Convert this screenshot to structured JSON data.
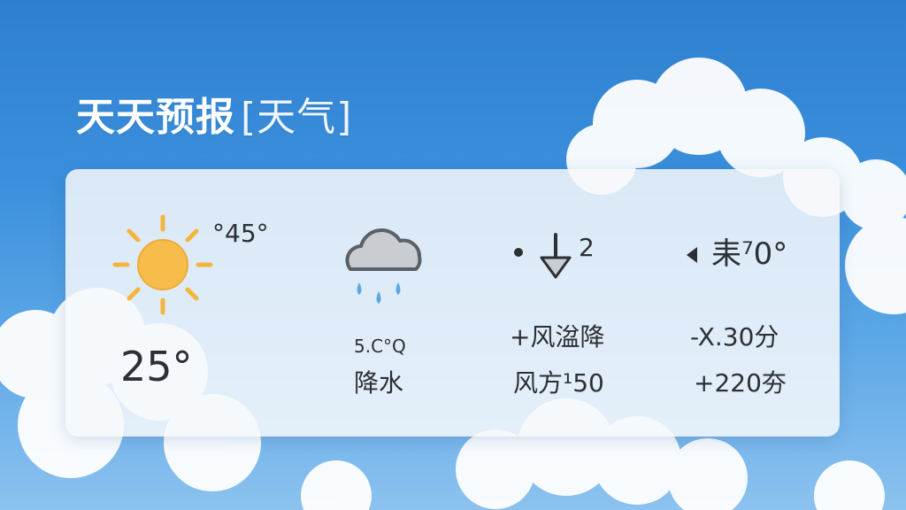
{
  "title": {
    "main": "天天预报",
    "suffix": "[天气]"
  },
  "sunny": {
    "icon": "sun-icon",
    "top_value": "°45°",
    "temperature": "25°"
  },
  "rain": {
    "icon": "rain-cloud-icon",
    "value": "5.C°Q",
    "label": "降水"
  },
  "wind": {
    "icon": "wind-arrow-icon",
    "top_value": "2",
    "line1": "+风湓降",
    "line2": "风方¹50"
  },
  "misc": {
    "icon": "left-triangle-icon",
    "top_value": "耒⁷0°",
    "line1": "-X.30分",
    "line2": "+220夯"
  },
  "colors": {
    "sky": "#3a8fdc",
    "card": "#f6f8fb",
    "sun": "#f5b53c",
    "rain": "#5aa9e6",
    "text": "#2c2f33"
  }
}
